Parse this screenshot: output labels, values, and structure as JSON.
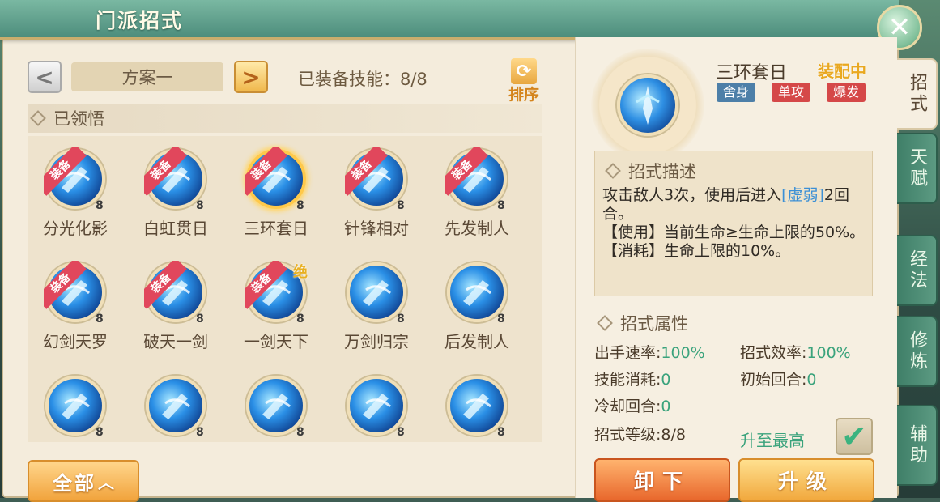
{
  "window": {
    "title": "门派招式",
    "close_label": "✕"
  },
  "plan": {
    "prev_label": "<",
    "name": "方案一",
    "next_label": ">",
    "equipped_text": "已装备技能：8/8",
    "sort_label": "排序"
  },
  "section": {
    "learned_label": "已领悟"
  },
  "skills": [
    {
      "name": "分光化影",
      "level": "8",
      "equipped": true,
      "ribbon": "装备"
    },
    {
      "name": "白虹贯日",
      "level": "8",
      "equipped": true,
      "ribbon": "装备"
    },
    {
      "name": "三环套日",
      "level": "8",
      "equipped": true,
      "ribbon": "装备",
      "selected": true
    },
    {
      "name": "针锋相对",
      "level": "8",
      "equipped": true,
      "ribbon": "装备"
    },
    {
      "name": "先发制人",
      "level": "8",
      "equipped": true,
      "ribbon": "装备"
    },
    {
      "name": "幻剑天罗",
      "level": "8",
      "equipped": true,
      "ribbon": "装备"
    },
    {
      "name": "破天一剑",
      "level": "8",
      "equipped": true,
      "ribbon": "装备"
    },
    {
      "name": "一剑天下",
      "level": "8",
      "equipped": true,
      "ribbon": "装备",
      "badge": "绝"
    },
    {
      "name": "万剑归宗",
      "level": "8",
      "equipped": false
    },
    {
      "name": "后发制人",
      "level": "8",
      "equipped": false
    },
    {
      "name": "",
      "level": "8",
      "equipped": false
    },
    {
      "name": "",
      "level": "8",
      "equipped": false
    },
    {
      "name": "",
      "level": "8",
      "equipped": false
    },
    {
      "name": "",
      "level": "8",
      "equipped": false
    },
    {
      "name": "",
      "level": "8",
      "equipped": false
    }
  ],
  "filter": {
    "label": "全部",
    "icon": "chevron-up-icon"
  },
  "detail": {
    "name": "三环套日",
    "status": "装配中",
    "tags": [
      "舍身",
      "单攻",
      "爆发"
    ],
    "desc_title": "招式描述",
    "desc_line1_pre": "攻击敌人3次，使用后进入",
    "desc_highlight": "[虚弱]",
    "desc_line1_post": "2回合。",
    "desc_use": "【使用】当前生命≥生命上限的50%。",
    "desc_cost": "【消耗】生命上限的10%。",
    "attr_title": "招式属性",
    "attrs": {
      "speed_label": "出手速率:",
      "speed_value": "100%",
      "efficiency_label": "招式效率:",
      "efficiency_value": "100%",
      "cost_label": "技能消耗:",
      "cost_value": "0",
      "start_round_label": "初始回合:",
      "start_round_value": "0",
      "cooldown_label": "冷却回合:",
      "cooldown_value": "0",
      "level_label": "招式等级:",
      "level_value": "8/8"
    },
    "max_label": "升至最高",
    "max_checked": true,
    "unequip_label": "卸下",
    "upgrade_label": "升级"
  },
  "side_tabs": [
    "招式",
    "天赋",
    "经法",
    "修炼",
    "辅助"
  ],
  "colors": {
    "equip_ribbon": "#e1475c",
    "accent_green": "#3aa37c",
    "gold": "#e9a820"
  }
}
